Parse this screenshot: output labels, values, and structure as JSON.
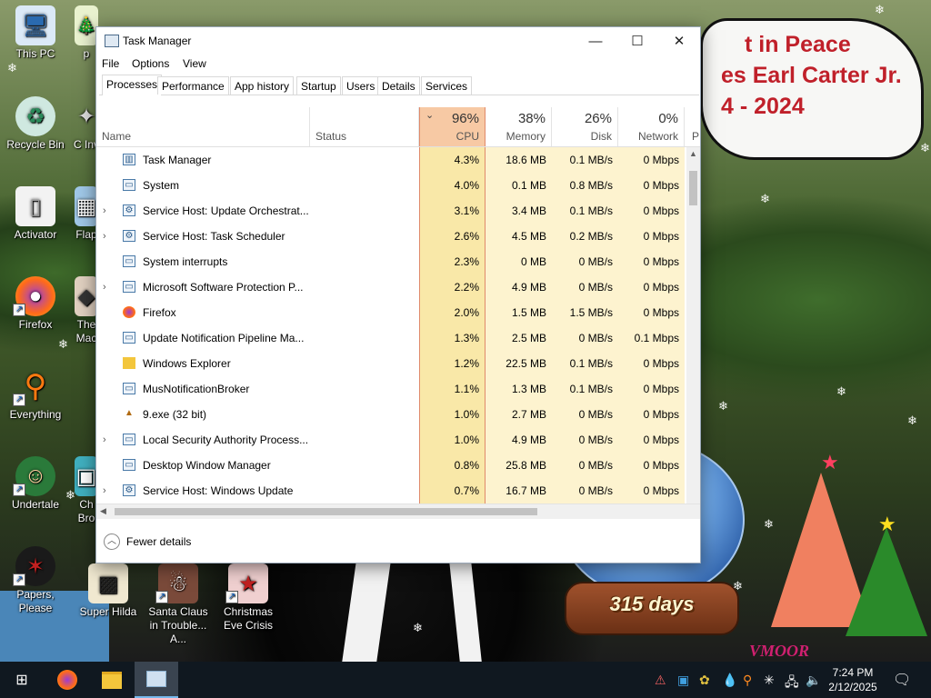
{
  "window": {
    "title": "Task Manager",
    "controls": {
      "minimize": "—",
      "maximize": "☐",
      "close": "✕"
    }
  },
  "menu": [
    "File",
    "Options",
    "View"
  ],
  "tabs": [
    "Processes",
    "Performance",
    "App history",
    "Startup",
    "Users",
    "Details",
    "Services"
  ],
  "selected_tab": "Processes",
  "columns": {
    "name": "Name",
    "status": "Status",
    "cpu": {
      "pct": "96%",
      "label": "CPU"
    },
    "memory": {
      "pct": "38%",
      "label": "Memory"
    },
    "disk": {
      "pct": "26%",
      "label": "Disk"
    },
    "network": {
      "pct": "0%",
      "label": "Network"
    },
    "power": "P"
  },
  "processes": [
    {
      "name": "Task Manager",
      "expand": "",
      "icon": "tm",
      "cpu": "4.3%",
      "mem": "18.6 MB",
      "disk": "0.1 MB/s",
      "net": "0 Mbps"
    },
    {
      "name": "System",
      "expand": "",
      "icon": "win",
      "cpu": "4.0%",
      "mem": "0.1 MB",
      "disk": "0.8 MB/s",
      "net": "0 Mbps"
    },
    {
      "name": "Service Host: Update Orchestrat...",
      "expand": "›",
      "icon": "gear",
      "cpu": "3.1%",
      "mem": "3.4 MB",
      "disk": "0.1 MB/s",
      "net": "0 Mbps"
    },
    {
      "name": "Service Host: Task Scheduler",
      "expand": "›",
      "icon": "gear",
      "cpu": "2.6%",
      "mem": "4.5 MB",
      "disk": "0.2 MB/s",
      "net": "0 Mbps"
    },
    {
      "name": "System interrupts",
      "expand": "",
      "icon": "win",
      "cpu": "2.3%",
      "mem": "0 MB",
      "disk": "0 MB/s",
      "net": "0 Mbps"
    },
    {
      "name": "Microsoft Software Protection P...",
      "expand": "›",
      "icon": "win",
      "cpu": "2.2%",
      "mem": "4.9 MB",
      "disk": "0 MB/s",
      "net": "0 Mbps"
    },
    {
      "name": "Firefox",
      "expand": "",
      "icon": "firefox",
      "cpu": "2.0%",
      "mem": "1.5 MB",
      "disk": "1.5 MB/s",
      "net": "0 Mbps"
    },
    {
      "name": "Update Notification Pipeline Ma...",
      "expand": "",
      "icon": "win",
      "cpu": "1.3%",
      "mem": "2.5 MB",
      "disk": "0 MB/s",
      "net": "0.1 Mbps"
    },
    {
      "name": "Windows Explorer",
      "expand": "",
      "icon": "folder",
      "cpu": "1.2%",
      "mem": "22.5 MB",
      "disk": "0.1 MB/s",
      "net": "0 Mbps"
    },
    {
      "name": "MusNotificationBroker",
      "expand": "",
      "icon": "win",
      "cpu": "1.1%",
      "mem": "1.3 MB",
      "disk": "0.1 MB/s",
      "net": "0 Mbps"
    },
    {
      "name": "9.exe (32 bit)",
      "expand": "",
      "icon": "tree",
      "cpu": "1.0%",
      "mem": "2.7 MB",
      "disk": "0 MB/s",
      "net": "0 Mbps"
    },
    {
      "name": "Local Security Authority Process...",
      "expand": "›",
      "icon": "win",
      "cpu": "1.0%",
      "mem": "4.9 MB",
      "disk": "0 MB/s",
      "net": "0 Mbps"
    },
    {
      "name": "Desktop Window Manager",
      "expand": "",
      "icon": "win",
      "cpu": "0.8%",
      "mem": "25.8 MB",
      "disk": "0 MB/s",
      "net": "0 Mbps"
    },
    {
      "name": "Service Host: Windows Update",
      "expand": "›",
      "icon": "gear",
      "cpu": "0.7%",
      "mem": "16.7 MB",
      "disk": "0 MB/s",
      "net": "0 Mbps"
    }
  ],
  "footer": {
    "fewer_details": "Fewer details"
  },
  "desktop_icons": [
    {
      "name": "This PC",
      "label": "This PC",
      "icon": "computer-icon"
    },
    {
      "name": "Recycle Bin",
      "label": "Recycle Bin",
      "icon": "recycle-bin-icon"
    },
    {
      "name": "Activator",
      "label": "Activator",
      "icon": "activator-icon"
    },
    {
      "name": "Firefox",
      "label": "Firefox",
      "icon": "firefox-icon"
    },
    {
      "name": "Everything",
      "label": "Everything",
      "icon": "everything-icon"
    },
    {
      "name": "Undertale",
      "label": "Undertale",
      "icon": "undertale-icon"
    },
    {
      "name": "Papers, Please",
      "label": "Papers, Please",
      "icon": "papers-please-icon"
    }
  ],
  "desktop_icons_row2": [
    {
      "label": "Super Hilda"
    },
    {
      "label": "Santa Claus in Trouble... A..."
    },
    {
      "label": "Christmas Eve Crisis"
    }
  ],
  "partial_icon_labels": [
    "p",
    "C Inv",
    "Flap",
    "The Mac",
    "Ch Bro"
  ],
  "banner": {
    "line1": "t in Peace",
    "line2": "es Earl Carter Jr.",
    "line3": "4 - 2024"
  },
  "globe": {
    "days": "315 days"
  },
  "tree_text": "VMOOR",
  "taskbar": {
    "clock_time": "7:24 PM",
    "clock_date": "2/12/2025",
    "apps": [
      "start-button",
      "firefox",
      "file-explorer",
      "task-manager"
    ]
  },
  "colors": {
    "cpu_highlight": "#f9e8a8",
    "cpu_header": "#f7c9a4",
    "accent": "#0078d7",
    "taskbar": "#101820"
  }
}
